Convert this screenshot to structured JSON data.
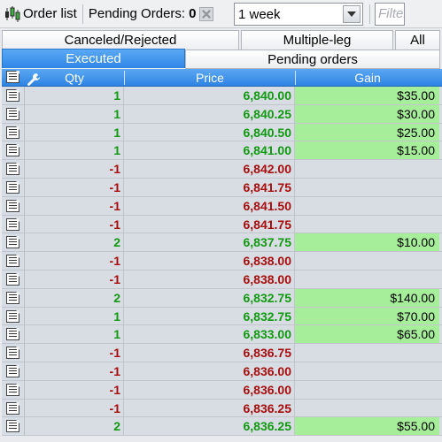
{
  "toolbar": {
    "icon": "candlestick-icon",
    "title": "Order list",
    "pending_label": "Pending Orders:",
    "pending_count": "0",
    "period_value": "1 week",
    "filter_placeholder": "Filter"
  },
  "tabs": {
    "row1": [
      "Canceled/Rejected",
      "Multiple-leg",
      "All"
    ],
    "executed": "Executed",
    "pending": "Pending orders",
    "active": "Executed"
  },
  "columns": {
    "qty": "Qty",
    "price": "Price",
    "gain": "Gain"
  },
  "rows": [
    {
      "qty": "1",
      "price": "6,840.00",
      "gain": "$35.00"
    },
    {
      "qty": "1",
      "price": "6,840.25",
      "gain": "$30.00"
    },
    {
      "qty": "1",
      "price": "6,840.50",
      "gain": "$25.00"
    },
    {
      "qty": "1",
      "price": "6,841.00",
      "gain": "$15.00"
    },
    {
      "qty": "-1",
      "price": "6,842.00",
      "gain": ""
    },
    {
      "qty": "-1",
      "price": "6,841.75",
      "gain": ""
    },
    {
      "qty": "-1",
      "price": "6,841.50",
      "gain": ""
    },
    {
      "qty": "-1",
      "price": "6,841.75",
      "gain": ""
    },
    {
      "qty": "2",
      "price": "6,837.75",
      "gain": "$10.00"
    },
    {
      "qty": "-1",
      "price": "6,838.00",
      "gain": ""
    },
    {
      "qty": "-1",
      "price": "6,838.00",
      "gain": ""
    },
    {
      "qty": "2",
      "price": "6,832.75",
      "gain": "$140.00"
    },
    {
      "qty": "1",
      "price": "6,832.75",
      "gain": "$70.00"
    },
    {
      "qty": "1",
      "price": "6,833.00",
      "gain": "$65.00"
    },
    {
      "qty": "-1",
      "price": "6,836.75",
      "gain": ""
    },
    {
      "qty": "-1",
      "price": "6,836.00",
      "gain": ""
    },
    {
      "qty": "-1",
      "price": "6,836.00",
      "gain": ""
    },
    {
      "qty": "-1",
      "price": "6,836.25",
      "gain": ""
    },
    {
      "qty": "2",
      "price": "6,836.25",
      "gain": "$55.00"
    }
  ],
  "colors": {
    "positive": "#109a10",
    "negative": "#a80d0d",
    "gain_highlight": "#a6ee9a",
    "accent": "#2f86e6"
  }
}
